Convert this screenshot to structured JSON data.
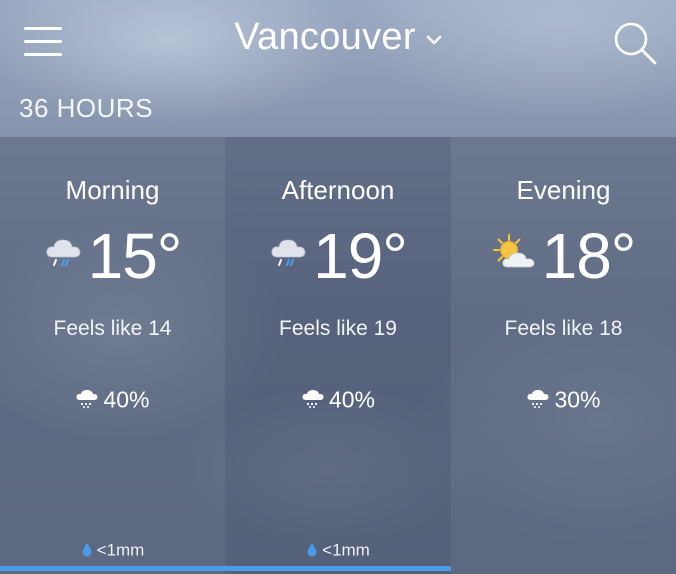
{
  "header": {
    "menu_icon": "hamburger-menu-icon",
    "city": "Vancouver",
    "dropdown_icon": "chevron-down-icon",
    "search_icon": "search-icon"
  },
  "section": {
    "title": "36 HOURS"
  },
  "periods": [
    {
      "name": "Morning",
      "icon": "cloud-rain-icon",
      "temp": "15°",
      "feels_like": "Feels like 14",
      "precip_icon": "cloud-rain-small-icon",
      "precip_chance": "40%",
      "amount_icon": "raindrop-icon",
      "amount": "<1mm"
    },
    {
      "name": "Afternoon",
      "icon": "cloud-rain-icon",
      "temp": "19°",
      "feels_like": "Feels like 19",
      "precip_icon": "cloud-rain-small-icon",
      "precip_chance": "40%",
      "amount_icon": "raindrop-icon",
      "amount": "<1mm"
    },
    {
      "name": "Evening",
      "icon": "sun-behind-cloud-icon",
      "temp": "18°",
      "feels_like": "Feels like 18",
      "precip_icon": "cloud-rain-small-icon",
      "precip_chance": "30%",
      "amount_icon": "",
      "amount": ""
    }
  ],
  "colors": {
    "accent": "#4a9be8",
    "sun": "#f5c542",
    "raindrop": "#4a9be8"
  }
}
